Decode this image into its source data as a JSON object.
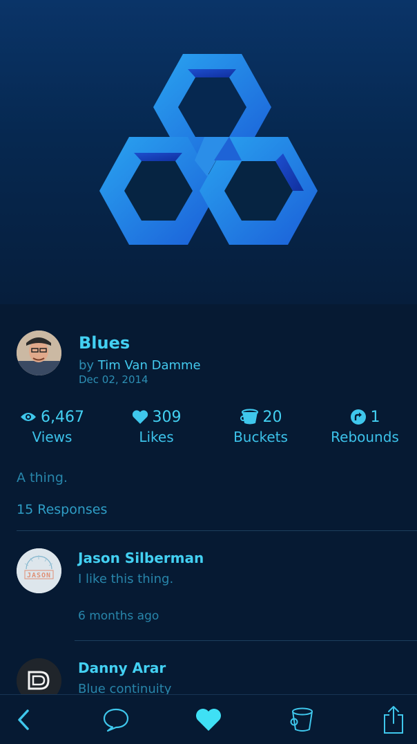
{
  "shot": {
    "title": "Blues",
    "by_prefix": "by",
    "author": "Tim Van Damme",
    "date": "Dec 02, 2014",
    "description": "A thing.",
    "responses_label": "15 Responses"
  },
  "stats": [
    {
      "icon": "eye-icon",
      "value": "6,467",
      "label": "Views"
    },
    {
      "icon": "heart-icon",
      "value": "309",
      "label": "Likes"
    },
    {
      "icon": "bucket-icon",
      "value": "20",
      "label": "Buckets"
    },
    {
      "icon": "rebound-icon",
      "value": "1",
      "label": "Rebounds"
    }
  ],
  "comments": [
    {
      "name": "Jason Silberman",
      "text": "I like this thing.",
      "time": "6 months ago",
      "avatar_text": "JASON"
    },
    {
      "name": "Danny Arar",
      "text": "Blue continuity",
      "time": ""
    }
  ],
  "tabbar": [
    "back-icon",
    "comment-icon",
    "heart-icon",
    "bucket-icon",
    "share-icon"
  ],
  "colors": {
    "accent": "#43d0f2",
    "background": "#061a33",
    "muted": "#2886ab"
  }
}
